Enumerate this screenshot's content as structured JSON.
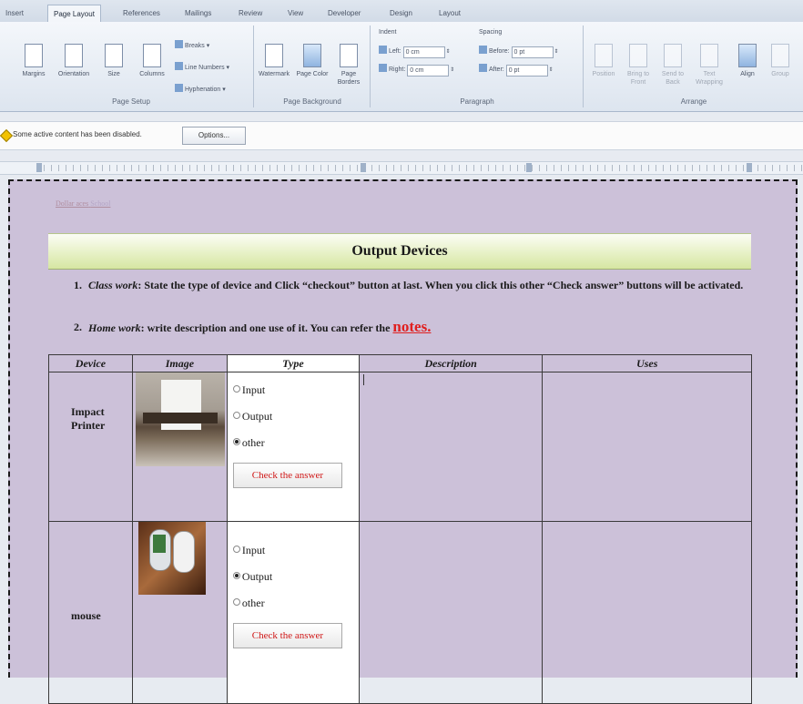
{
  "tabs": [
    "Insert",
    "Page Layout",
    "References",
    "Mailings",
    "Review",
    "View",
    "Developer",
    "Design",
    "Layout"
  ],
  "active_tab": "Page Layout",
  "ribbon": {
    "page_setup": {
      "label": "Page Setup",
      "buttons": [
        "Margins",
        "Orientation",
        "Size",
        "Columns"
      ],
      "small": [
        "Breaks",
        "Line Numbers",
        "Hyphenation"
      ]
    },
    "page_background": {
      "label": "Page Background",
      "buttons": [
        "Watermark",
        "Page Color",
        "Page Borders"
      ]
    },
    "paragraph": {
      "label": "Paragraph",
      "indent_label": "Indent",
      "spacing_label": "Spacing",
      "left_label": "Left:",
      "left_value": "0 cm",
      "right_label": "Right:",
      "right_value": "0 cm",
      "before_label": "Before:",
      "before_value": "0 pt",
      "after_label": "After:",
      "after_value": "0 pt"
    },
    "arrange": {
      "label": "Arrange",
      "buttons": [
        "Position",
        "Bring to Front",
        "Send to Back",
        "Text Wrapping",
        "Align",
        "Group"
      ]
    }
  },
  "security_bar": {
    "message": "Some active content has been disabled.",
    "options_label": "Options..."
  },
  "document": {
    "header_link": "Dollar aces",
    "header_rest": "School",
    "title": "Output Devices",
    "instructions": [
      {
        "num": "1.",
        "label": "Class work",
        "text": ": State the type of device and Click “checkout” button at last. When you click this other “Check answer” buttons will be activated."
      },
      {
        "num": "2.",
        "label": "Home work",
        "text": ": write description and one use of it. You can refer the ",
        "link": "notes."
      }
    ],
    "table": {
      "headers": [
        "Device",
        "Image",
        "Type",
        "Description",
        "Uses"
      ],
      "rows": [
        {
          "device": "Impact Printer",
          "image": "printer-photo",
          "options": [
            "Input",
            "Output",
            "other"
          ],
          "selected": 2,
          "button": "Check the answer"
        },
        {
          "device": "mouse",
          "image": "mouse-photo",
          "options": [
            "Input",
            "Output",
            "other"
          ],
          "selected": 1,
          "button": "Check the answer"
        }
      ]
    }
  }
}
